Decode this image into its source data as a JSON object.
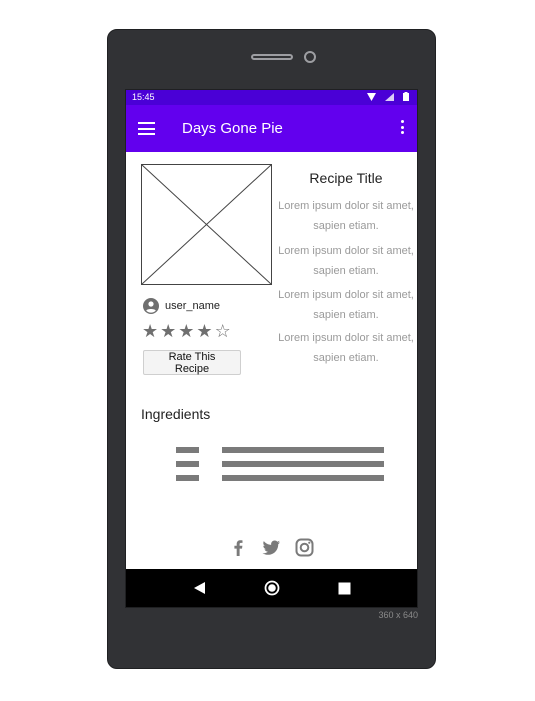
{
  "device": {
    "size_label": "360 x 640"
  },
  "status_bar": {
    "time": "15:45"
  },
  "app_bar": {
    "title": "Days Gone Pie"
  },
  "recipe": {
    "title": "Recipe Title",
    "description": [
      "Lorem ipsum dolor sit amet, sapien etiam.",
      "Lorem ipsum dolor sit amet, sapien etiam.",
      "Lorem ipsum dolor sit amet, sapien etiam.",
      "Lorem ipsum dolor sit amet, sapien etiam."
    ]
  },
  "user": {
    "name": "user_name"
  },
  "rating": {
    "value": 4,
    "max": 5
  },
  "rate_button": {
    "label": "Rate This Recipe"
  },
  "ingredients": {
    "title": "Ingredients"
  },
  "social": [
    "facebook-icon",
    "twitter-icon",
    "instagram-icon"
  ],
  "colors": {
    "status_bar": "#4a00d6",
    "app_bar": "#6200ee",
    "icon_gray": "#7a7a7a"
  }
}
